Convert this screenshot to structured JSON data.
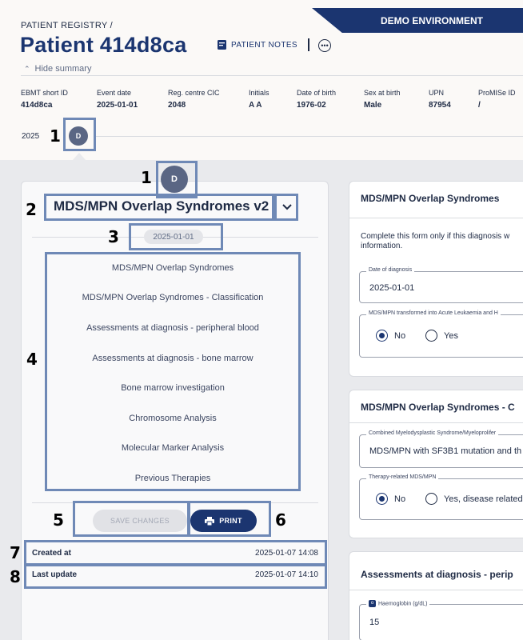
{
  "header": {
    "environment_banner": "DEMO ENVIRONMENT",
    "breadcrumb": "PATIENT REGISTRY  /",
    "title": "Patient 414d8ca",
    "notes_label": "PATIENT NOTES",
    "hide_summary_label": "Hide summary"
  },
  "summary": [
    {
      "label": "EBMT short ID",
      "value": "414d8ca"
    },
    {
      "label": "Event date",
      "value": "2025-01-01"
    },
    {
      "label": "Reg. centre CIC",
      "value": "2048"
    },
    {
      "label": "Initials",
      "value": "A A"
    },
    {
      "label": "Date of birth",
      "value": "1976-02"
    },
    {
      "label": "Sex at birth",
      "value": "Male"
    },
    {
      "label": "UPN",
      "value": "87954"
    },
    {
      "label": "ProMISe ID",
      "value": "/"
    }
  ],
  "timeline": {
    "year": "2025",
    "event_letter": "D"
  },
  "event_panel": {
    "event_letter": "D",
    "form_name": "MDS/MPN Overlap Syndromes v2",
    "event_date": "2025-01-01",
    "sections": [
      "MDS/MPN Overlap Syndromes",
      "MDS/MPN Overlap Syndromes - Classification",
      "Assessments at diagnosis - peripheral blood",
      "Assessments at diagnosis - bone marrow",
      "Bone marrow investigation",
      "Chromosome Analysis",
      "Molecular Marker Analysis",
      "Previous Therapies"
    ],
    "save_label": "SAVE CHANGES",
    "print_label": "PRINT",
    "created_label": "Created at",
    "created_value": "2025-01-07 14:08",
    "updated_label": "Last update",
    "updated_value": "2025-01-07 14:10"
  },
  "annotations": [
    "1",
    "1",
    "2",
    "3",
    "4",
    "5",
    "6",
    "7",
    "8"
  ],
  "cards": {
    "overview": {
      "title": "MDS/MPN Overlap Syndromes",
      "desc_line1": "Complete this form only if this diagnosis w",
      "desc_line2": "information.",
      "date_legend": "Date of diagnosis",
      "date_value": "2025-01-01",
      "transformed_legend": "MDS/MPN transformed into Acute Leukaemia and H",
      "opt_no": "No",
      "opt_yes": "Yes"
    },
    "classification": {
      "title": "MDS/MPN Overlap Syndromes - C",
      "combined_legend": "Combined Myelodysplastic Syndrome/Myeloprolifer",
      "combined_value": "MDS/MPN with SF3B1 mutation and th",
      "therapy_legend": "Therapy-related MDS/MPN",
      "opt_no": "No",
      "opt_yes": "Yes, disease related"
    },
    "peripheral": {
      "title": "Assessments at diagnosis - perip",
      "hb_badge": "o",
      "hb_legend": "Haemoglobin (g/dL)",
      "hb_value": "15"
    }
  },
  "colors": {
    "brand": "#1b3570",
    "annotation": "#6f89b6",
    "event_circle": "#5a6684"
  }
}
